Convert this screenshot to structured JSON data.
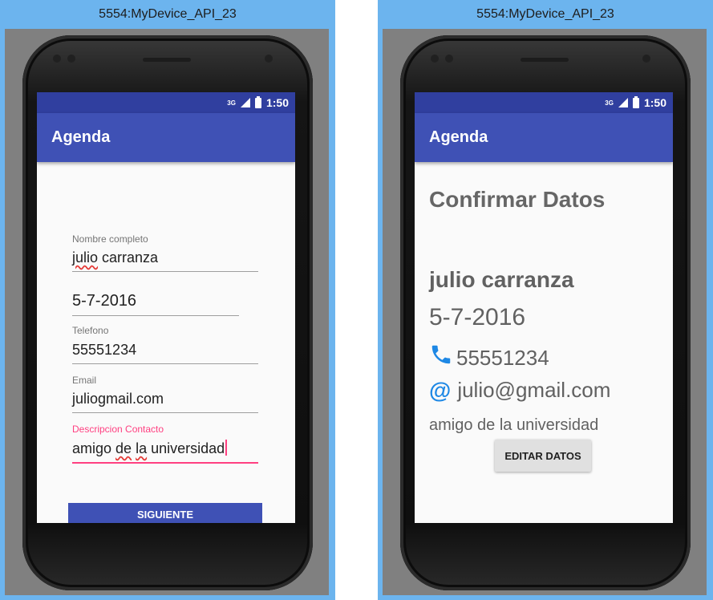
{
  "left_window": {
    "title": "5554:MyDevice_API_23",
    "status": {
      "network": "3G",
      "time": "1:50"
    },
    "app_title": "Agenda",
    "form": {
      "nombre_label": "Nombre completo",
      "nombre_value_word1": "julio",
      "nombre_value_rest": " carranza",
      "fecha_value": "5-7-2016",
      "telefono_label": "Telefono",
      "telefono_value": "55551234",
      "email_label": "Email",
      "email_value": "juliogmail.com",
      "descripcion_label": "Descripcion Contacto",
      "descripcion_part1": "amigo ",
      "descripcion_part2": "de",
      "descripcion_part3": " ",
      "descripcion_part4": "la",
      "descripcion_part5": " universidad",
      "siguiente_label": "SIGUIENTE"
    }
  },
  "right_window": {
    "title": "5554:MyDevice_API_23",
    "status": {
      "network": "3G",
      "time": "1:50"
    },
    "app_title": "Agenda",
    "confirm": {
      "heading": "Confirmar Datos",
      "name": "julio carranza",
      "date": "5-7-2016",
      "phone_icon": "phone-icon",
      "phone": "55551234",
      "email_icon": "at-sign-icon",
      "email": "julio@gmail.com",
      "description": "amigo de la universidad",
      "edit_label": "EDITAR DATOS"
    }
  },
  "colors": {
    "emulator_frame": "#6cb4ee",
    "status_bar": "#303f9f",
    "app_bar": "#3f51b5",
    "accent": "#ff4081",
    "icon_blue": "#1e88e5"
  }
}
